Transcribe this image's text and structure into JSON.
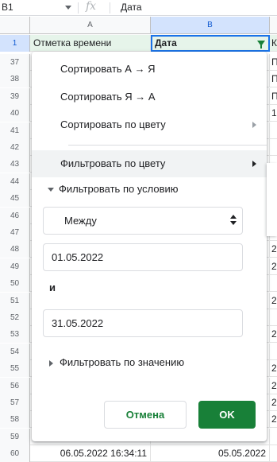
{
  "formula_bar": {
    "cell_ref": "B1",
    "fx_label": "fx",
    "content": "Дата"
  },
  "columns": {
    "a": "A",
    "b": "B"
  },
  "header_row": {
    "num": "1",
    "a": "Отметка времени",
    "b": "Дата",
    "c": "К"
  },
  "rows": [
    {
      "num": "37",
      "a": "",
      "b": "",
      "c": "П"
    },
    {
      "num": "38",
      "a": "",
      "b": "",
      "c": "П"
    },
    {
      "num": "39",
      "a": "",
      "b": "",
      "c": "П"
    },
    {
      "num": "40",
      "a": "",
      "b": "",
      "c": "1"
    },
    {
      "num": "41",
      "a": "",
      "b": "",
      "c": ""
    },
    {
      "num": "42",
      "a": "",
      "b": "",
      "c": ""
    },
    {
      "num": "43",
      "a": "",
      "b": "",
      "c": ""
    },
    {
      "num": "44",
      "a": "",
      "b": "",
      "c": ""
    },
    {
      "num": "45",
      "a": "",
      "b": "",
      "c": ""
    },
    {
      "num": "46",
      "a": "",
      "b": "",
      "c": ""
    },
    {
      "num": "47",
      "a": "",
      "b": "",
      "c": ""
    },
    {
      "num": "48",
      "a": "",
      "b": "",
      "c": "2"
    },
    {
      "num": "49",
      "a": "",
      "b": "",
      "c": "2"
    },
    {
      "num": "50",
      "a": "",
      "b": "",
      "c": ""
    },
    {
      "num": "51",
      "a": "",
      "b": "",
      "c": "2"
    },
    {
      "num": "52",
      "a": "",
      "b": "",
      "c": ""
    },
    {
      "num": "53",
      "a": "",
      "b": "",
      "c": "2"
    },
    {
      "num": "54",
      "a": "",
      "b": "",
      "c": ""
    },
    {
      "num": "55",
      "a": "",
      "b": "",
      "c": "2"
    },
    {
      "num": "56",
      "a": "",
      "b": "",
      "c": "2"
    },
    {
      "num": "57",
      "a": "",
      "b": "",
      "c": "2"
    },
    {
      "num": "58",
      "a": "",
      "b": "",
      "c": "2"
    },
    {
      "num": "59",
      "a": "",
      "b": "",
      "c": ""
    },
    {
      "num": "60",
      "a": "06.05.2022 16:34:11",
      "b": "05.05.2022",
      "c": ""
    }
  ],
  "menu": {
    "sort_az": "Сортировать А → Я",
    "sort_za": "Сортировать Я → А",
    "sort_color": "Сортировать по цвету",
    "filter_color": "Фильтровать по цвету",
    "filter_condition": "Фильтровать по условию",
    "condition_select": "Между",
    "date_from": "01.05.2022",
    "and_label": "и",
    "date_to": "31.05.2022",
    "filter_values": "Фильтровать по значению",
    "cancel": "Отмена",
    "ok": "OK"
  }
}
